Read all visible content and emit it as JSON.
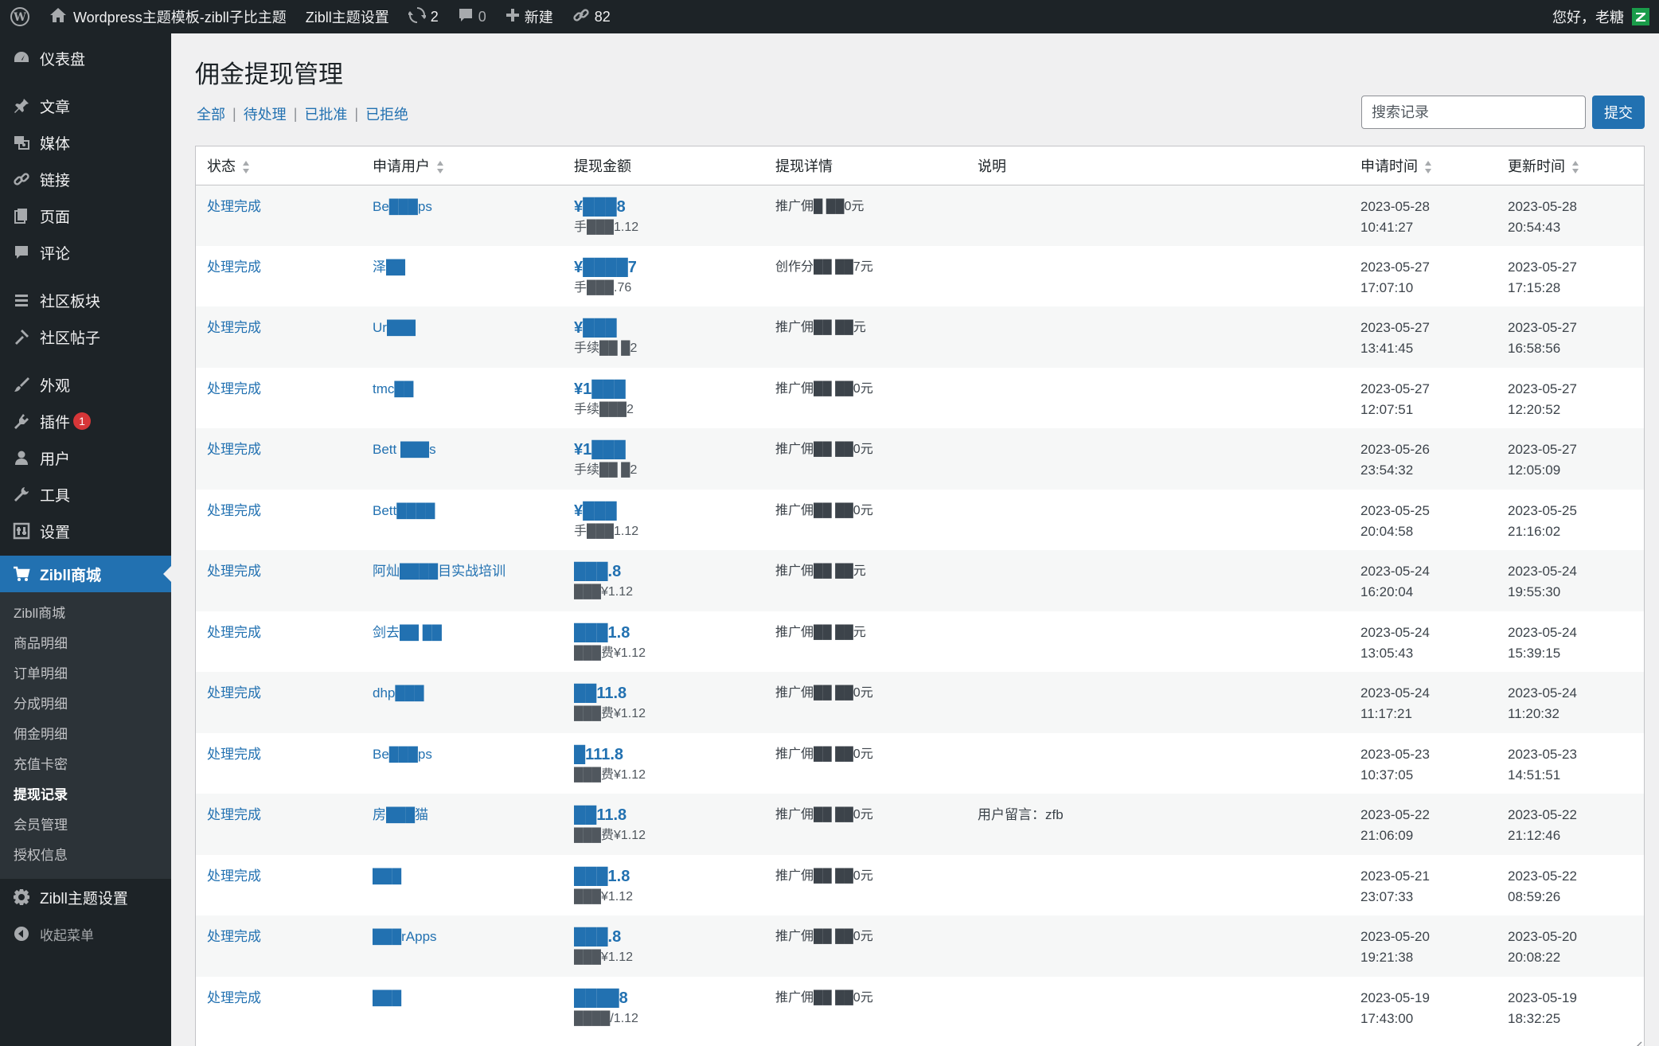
{
  "adminbar": {
    "site_name": "Wordpress主题模板-zibll子比主题",
    "theme_settings": "Zibll主题设置",
    "updates_count": "2",
    "comments_count": "0",
    "new_label": "新建",
    "links_count": "82",
    "greeting": "您好，老糖"
  },
  "sidebar": {
    "items": [
      {
        "label": "仪表盘",
        "icon": "dashboard-icon"
      },
      {
        "label": "文章",
        "icon": "pin-icon"
      },
      {
        "label": "媒体",
        "icon": "media-icon"
      },
      {
        "label": "链接",
        "icon": "link-icon"
      },
      {
        "label": "页面",
        "icon": "page-icon"
      },
      {
        "label": "评论",
        "icon": "comment-icon"
      },
      {
        "label": "社区板块",
        "icon": "forum-icon"
      },
      {
        "label": "社区帖子",
        "icon": "hammer-icon"
      },
      {
        "label": "外观",
        "icon": "brush-icon"
      },
      {
        "label": "插件",
        "icon": "plugin-icon",
        "badge": "1"
      },
      {
        "label": "用户",
        "icon": "user-icon"
      },
      {
        "label": "工具",
        "icon": "wrench-icon"
      },
      {
        "label": "设置",
        "icon": "settings-icon"
      },
      {
        "label": "Zibll商城",
        "icon": "cart-icon"
      }
    ],
    "submenu": [
      "Zibll商城",
      "商品明细",
      "订单明细",
      "分成明细",
      "佣金明细",
      "充值卡密",
      "提现记录",
      "会员管理",
      "授权信息"
    ],
    "current_submenu": "提现记录",
    "theme_settings": "Zibll主题设置",
    "collapse": "收起菜单"
  },
  "page": {
    "title": "佣金提现管理",
    "filters": [
      "全部",
      "待处理",
      "已批准",
      "已拒绝"
    ],
    "search_placeholder": "搜索记录",
    "submit_label": "提交"
  },
  "table": {
    "columns": [
      "状态",
      "申请用户",
      "提现金额",
      "提现详情",
      "说明",
      "申请时间",
      "更新时间"
    ],
    "rows": [
      {
        "status": "处理完成",
        "user": "Be███ps",
        "amount": "¥███8",
        "fee": "手███1.12",
        "detail": "推广佣█ ██0元",
        "note": "",
        "applied_date": "2023-05-28",
        "applied_time": "10:41:27",
        "updated_date": "2023-05-28",
        "updated_time": "20:54:43"
      },
      {
        "status": "处理完成",
        "user": "泽██",
        "amount": "¥████7",
        "fee": "手███.76",
        "detail": "创作分██ ██7元",
        "note": "",
        "applied_date": "2023-05-27",
        "applied_time": "17:07:10",
        "updated_date": "2023-05-27",
        "updated_time": "17:15:28"
      },
      {
        "status": "处理完成",
        "user": "Ur███",
        "amount": "¥███",
        "fee": "手续██ █2",
        "detail": "推广佣██ ██元",
        "note": "",
        "applied_date": "2023-05-27",
        "applied_time": "13:41:45",
        "updated_date": "2023-05-27",
        "updated_time": "16:58:56"
      },
      {
        "status": "处理完成",
        "user": "tmc██",
        "amount": "¥1███",
        "fee": "手续███2",
        "detail": "推广佣██ ██0元",
        "note": "",
        "applied_date": "2023-05-27",
        "applied_time": "12:07:51",
        "updated_date": "2023-05-27",
        "updated_time": "12:20:52"
      },
      {
        "status": "处理完成",
        "user": "Bett ███s",
        "amount": "¥1███",
        "fee": "手续██ █2",
        "detail": "推广佣██ ██0元",
        "note": "",
        "applied_date": "2023-05-26",
        "applied_time": "23:54:32",
        "updated_date": "2023-05-27",
        "updated_time": "12:05:09"
      },
      {
        "status": "处理完成",
        "user": "Bett████",
        "amount": "¥███",
        "fee": "手███1.12",
        "detail": "推广佣██ ██0元",
        "note": "",
        "applied_date": "2023-05-25",
        "applied_time": "20:04:58",
        "updated_date": "2023-05-25",
        "updated_time": "21:16:02"
      },
      {
        "status": "处理完成",
        "user": "阿灿████目实战培训",
        "amount": "███.8",
        "fee": "███¥1.12",
        "detail": "推广佣██ ██元",
        "note": "",
        "applied_date": "2023-05-24",
        "applied_time": "16:20:04",
        "updated_date": "2023-05-24",
        "updated_time": "19:55:30"
      },
      {
        "status": "处理完成",
        "user": "剑去██ ██",
        "amount": "███1.8",
        "fee": "███费¥1.12",
        "detail": "推广佣██ ██元",
        "note": "",
        "applied_date": "2023-05-24",
        "applied_time": "13:05:43",
        "updated_date": "2023-05-24",
        "updated_time": "15:39:15"
      },
      {
        "status": "处理完成",
        "user": "dhp███",
        "amount": "██11.8",
        "fee": "███费¥1.12",
        "detail": "推广佣██ ██0元",
        "note": "",
        "applied_date": "2023-05-24",
        "applied_time": "11:17:21",
        "updated_date": "2023-05-24",
        "updated_time": "11:20:32"
      },
      {
        "status": "处理完成",
        "user": "Be███ps",
        "amount": "█111.8",
        "fee": "███费¥1.12",
        "detail": "推广佣██ ██0元",
        "note": "",
        "applied_date": "2023-05-23",
        "applied_time": "10:37:05",
        "updated_date": "2023-05-23",
        "updated_time": "14:51:51"
      },
      {
        "status": "处理完成",
        "user": "房███猫",
        "amount": "██11.8",
        "fee": "███费¥1.12",
        "detail": "推广佣██ ██0元",
        "note": "用户留言：zfb",
        "applied_date": "2023-05-22",
        "applied_time": "21:06:09",
        "updated_date": "2023-05-22",
        "updated_time": "21:12:46"
      },
      {
        "status": "处理完成",
        "user": "███",
        "amount": "███1.8",
        "fee": "███¥1.12",
        "detail": "推广佣██ ██0元",
        "note": "",
        "applied_date": "2023-05-21",
        "applied_time": "23:07:33",
        "updated_date": "2023-05-22",
        "updated_time": "08:59:26"
      },
      {
        "status": "处理完成",
        "user": "███rApps",
        "amount": "███.8",
        "fee": "███¥1.12",
        "detail": "推广佣██ ██0元",
        "note": "",
        "applied_date": "2023-05-20",
        "applied_time": "19:21:38",
        "updated_date": "2023-05-20",
        "updated_time": "20:08:22"
      },
      {
        "status": "处理完成",
        "user": "███",
        "amount": "████8",
        "fee": "████/1.12",
        "detail": "推广佣██ ██0元",
        "note": "",
        "applied_date": "2023-05-19",
        "applied_time": "17:43:00",
        "updated_date": "2023-05-19",
        "updated_time": "18:32:25"
      }
    ]
  }
}
